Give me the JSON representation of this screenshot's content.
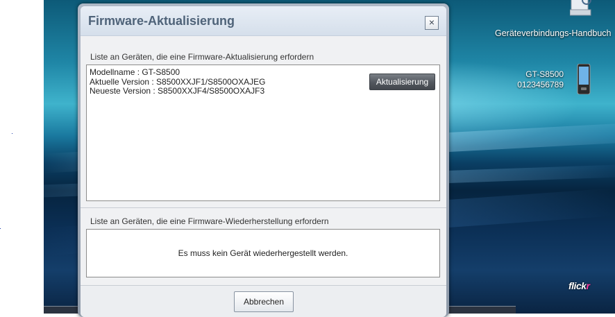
{
  "dialog": {
    "title": "Firmware-Aktualisierung",
    "close_symbol": "×",
    "update_section": {
      "label": "Liste an Geräten, die eine Firmware-Aktualisierung erfordern",
      "device": {
        "model_line": "Modellname : GT-S8500",
        "current_line": "Aktuelle Version : S8500XXJF1/S8500OXAJEG",
        "latest_line": "Neueste Version : S8500XXJF4/S8500OXAJF3"
      },
      "update_button": "Aktualisierung"
    },
    "restore_section": {
      "label": "Liste an Geräten, die eine Firmware-Wiederherstellung erfordern",
      "empty_message": "Es muss kein Gerät wiederhergestellt werden."
    },
    "cancel_button": "Abbrechen"
  },
  "desktop": {
    "manual_label": "Geräteverbindungs-Handbuch",
    "device_model": "GT-S8500",
    "device_number": "0123456789",
    "flickr_main": "flick",
    "flickr_r": "r"
  },
  "icons": {
    "manual": "document-magnifier-icon",
    "phone": "mobile-phone-icon",
    "close": "close-icon"
  },
  "colors": {
    "title_text": "#4f6379",
    "update_button": "#52575e",
    "flickr_accent": "#ff3fa5"
  }
}
